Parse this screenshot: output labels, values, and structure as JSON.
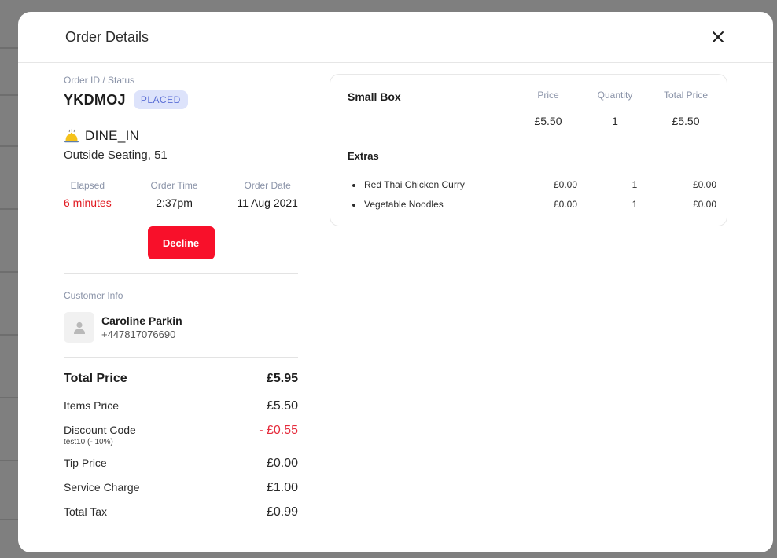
{
  "modal": {
    "title": "Order Details"
  },
  "order": {
    "id_label": "Order ID / Status",
    "id": "YKDMOJ",
    "status": "PLACED",
    "type": "DINE_IN",
    "location": "Outside Seating, 51"
  },
  "meta": [
    {
      "label": "Elapsed",
      "value": "6 minutes"
    },
    {
      "label": "Order Time",
      "value": "2:37pm"
    },
    {
      "label": "Order Date",
      "value": "11 Aug 2021"
    }
  ],
  "actions": {
    "decline_label": "Decline"
  },
  "customer": {
    "label": "Customer Info",
    "name": "Caroline Parkin",
    "phone": "+447817076690"
  },
  "totals": {
    "total_price": {
      "label": "Total Price",
      "value": "£5.95"
    },
    "items_price": {
      "label": "Items Price",
      "value": "£5.50"
    },
    "discount": {
      "label": "Discount Code",
      "note": "test10 (- 10%)",
      "value": "- £0.55"
    },
    "tip": {
      "label": "Tip Price",
      "value": "£0.00"
    },
    "service": {
      "label": "Service Charge",
      "value": "£1.00"
    },
    "tax": {
      "label": "Total Tax",
      "value": "£0.99"
    }
  },
  "items_table": {
    "headers": {
      "price": "Price",
      "quantity": "Quantity",
      "total": "Total Price"
    },
    "item": {
      "name": "Small Box",
      "price": "£5.50",
      "quantity": "1",
      "total": "£5.50"
    },
    "extras_title": "Extras",
    "extras": [
      {
        "name": "Red Thai Chicken Curry",
        "price": "£0.00",
        "quantity": "1",
        "total": "£0.00"
      },
      {
        "name": "Vegetable Noodles",
        "price": "£0.00",
        "quantity": "1",
        "total": "£0.00"
      }
    ]
  },
  "colors": {
    "decline": "#f8102a",
    "elapsed": "#e11b22",
    "discount": "#e52d3d",
    "status_bg": "#dde3fb",
    "status_text": "#5a6ed6"
  },
  "icons": {
    "close": "close-icon",
    "dine_in": "cloche-icon",
    "avatar": "user-icon"
  }
}
